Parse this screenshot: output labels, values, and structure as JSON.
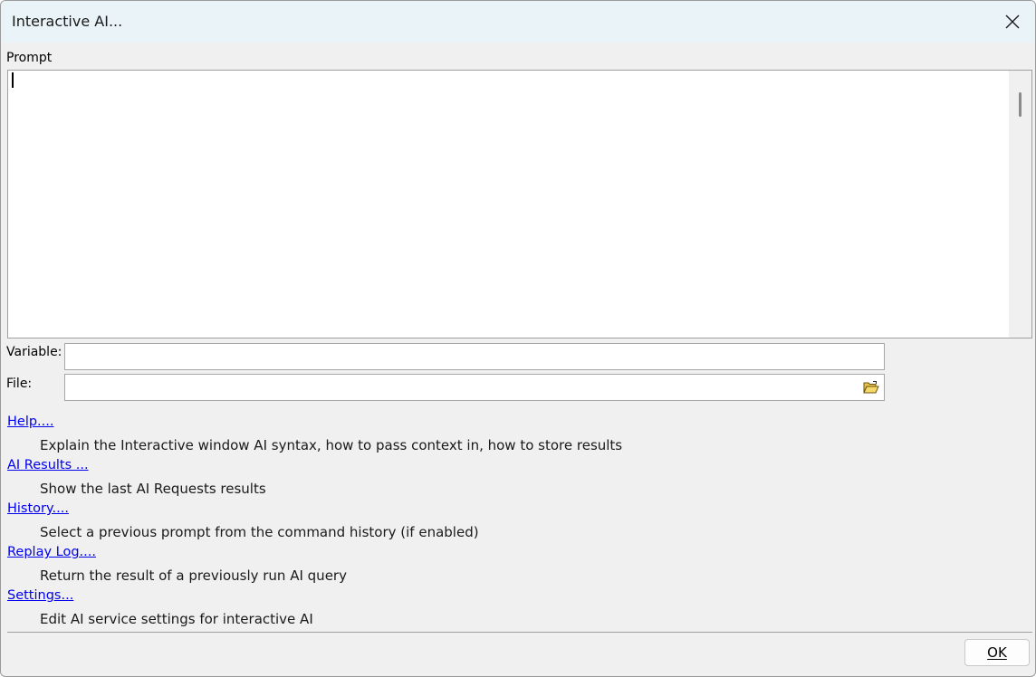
{
  "window": {
    "title": "Interactive AI..."
  },
  "prompt": {
    "label": "Prompt",
    "value": ""
  },
  "variable": {
    "label": "Variable:",
    "value": ""
  },
  "file": {
    "label": "File:",
    "value": "",
    "browse_icon": "folder-open-icon"
  },
  "links": [
    {
      "label": "Help....",
      "description": "Explain the Interactive window AI syntax, how to pass context in, how to store results"
    },
    {
      "label": "AI Results ...",
      "description": "Show the last AI Requests results"
    },
    {
      "label": "History....",
      "description": "Select a previous prompt from the command history (if enabled)"
    },
    {
      "label": "Replay Log....",
      "description": "Return the result of a previously run AI query"
    },
    {
      "label": "Settings...",
      "description": "Edit AI service settings for interactive AI"
    }
  ],
  "buttons": {
    "ok": "OK"
  },
  "colors": {
    "link": "#0000ee",
    "titlebar": "#eaf4f8",
    "dialog_bg": "#f0f0f0"
  }
}
